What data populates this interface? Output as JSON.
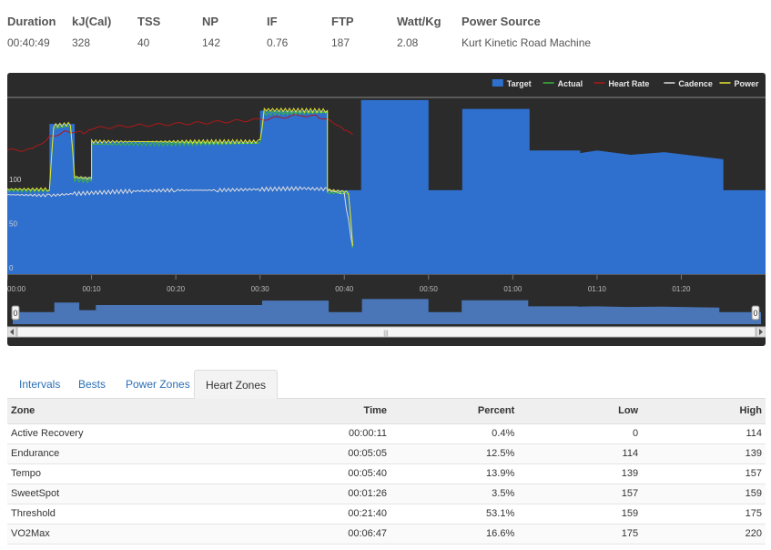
{
  "summary": [
    {
      "label": "Duration",
      "value": "00:40:49"
    },
    {
      "label": "kJ(Cal)",
      "value": "328"
    },
    {
      "label": "TSS",
      "value": "40"
    },
    {
      "label": "NP",
      "value": "142"
    },
    {
      "label": "IF",
      "value": "0.76"
    },
    {
      "label": "FTP",
      "value": "187"
    },
    {
      "label": "Watt/Kg",
      "value": "2.08"
    },
    {
      "label": "Power Source",
      "value": "Kurt Kinetic Road Machine"
    }
  ],
  "chart": {
    "legend": [
      {
        "name": "Target",
        "color": "#2f6fce",
        "kind": "box"
      },
      {
        "name": "Actual",
        "color": "#3cb43c",
        "kind": "line"
      },
      {
        "name": "Heart Rate",
        "color": "#b01818",
        "kind": "line"
      },
      {
        "name": "Cadence",
        "color": "#dddddd",
        "kind": "line"
      },
      {
        "name": "Power",
        "color": "#e6e632",
        "kind": "line"
      }
    ],
    "y_ticks": [
      "100",
      "50",
      "0"
    ],
    "x_ticks": [
      "00:00",
      "00:10",
      "00:20",
      "00:30",
      "00:40",
      "00:50",
      "01:00",
      "01:10",
      "01:20"
    ],
    "navigator_handle_left": "0",
    "navigator_handle_right": "0",
    "scroll_grip": "|||"
  },
  "chart_data": {
    "type": "area",
    "x_unit": "minutes",
    "xlim": [
      0,
      90
    ],
    "ylim": [
      0,
      200
    ],
    "series": [
      {
        "name": "Target",
        "points": [
          [
            0,
            95
          ],
          [
            5,
            95
          ],
          [
            5,
            170
          ],
          [
            8,
            170
          ],
          [
            8,
            110
          ],
          [
            10,
            110
          ],
          [
            10,
            150
          ],
          [
            30,
            150
          ],
          [
            30,
            185
          ],
          [
            38,
            185
          ],
          [
            38,
            95
          ],
          [
            42,
            95
          ],
          [
            42,
            197
          ],
          [
            50,
            197
          ],
          [
            50,
            95
          ],
          [
            54,
            95
          ],
          [
            54,
            187
          ],
          [
            62,
            187
          ],
          [
            62,
            140
          ],
          [
            68,
            140
          ],
          [
            68,
            137
          ],
          [
            70,
            140
          ],
          [
            74,
            135
          ],
          [
            78,
            138
          ],
          [
            85,
            130
          ],
          [
            85,
            95
          ],
          [
            90,
            95
          ]
        ]
      },
      {
        "name": "Actual",
        "points": [
          [
            0,
            95
          ],
          [
            5,
            95
          ],
          [
            5.5,
            165
          ],
          [
            7.5,
            168
          ],
          [
            8,
            107
          ],
          [
            10,
            105
          ],
          [
            10,
            147
          ],
          [
            30,
            148
          ],
          [
            30.5,
            182
          ],
          [
            38,
            183
          ],
          [
            38,
            92
          ],
          [
            40.5,
            92
          ],
          [
            41,
            30
          ]
        ]
      },
      {
        "name": "Heart Rate",
        "points": [
          [
            0,
            140
          ],
          [
            3,
            141
          ],
          [
            5,
            155
          ],
          [
            7,
            162
          ],
          [
            9,
            160
          ],
          [
            10,
            165
          ],
          [
            15,
            168
          ],
          [
            20,
            170
          ],
          [
            25,
            172
          ],
          [
            30,
            175
          ],
          [
            35,
            180
          ],
          [
            37,
            178
          ],
          [
            39,
            170
          ],
          [
            40,
            162
          ],
          [
            41,
            158
          ]
        ]
      },
      {
        "name": "Cadence",
        "points": [
          [
            0,
            90
          ],
          [
            5,
            89
          ],
          [
            8,
            91
          ],
          [
            10,
            92
          ],
          [
            15,
            94
          ],
          [
            20,
            95
          ],
          [
            25,
            95
          ],
          [
            30,
            96
          ],
          [
            35,
            97
          ],
          [
            38,
            96
          ],
          [
            40,
            90
          ],
          [
            41,
            30
          ]
        ]
      },
      {
        "name": "Power",
        "points": [
          [
            0,
            96
          ],
          [
            5,
            96
          ],
          [
            5.5,
            168
          ],
          [
            7.5,
            170
          ],
          [
            8,
            110
          ],
          [
            10,
            108
          ],
          [
            10,
            150
          ],
          [
            30,
            150
          ],
          [
            30.5,
            186
          ],
          [
            38,
            185
          ],
          [
            38,
            95
          ],
          [
            40.5,
            93
          ],
          [
            41,
            32
          ]
        ]
      }
    ]
  },
  "tabs": [
    {
      "label": "Intervals",
      "active": false
    },
    {
      "label": "Bests",
      "active": false
    },
    {
      "label": "Power Zones",
      "active": false
    },
    {
      "label": "Heart Zones",
      "active": true
    }
  ],
  "zones_table": {
    "headers": [
      "Zone",
      "Time",
      "Percent",
      "Low",
      "High"
    ],
    "rows": [
      [
        "Active Recovery",
        "00:00:11",
        "0.4%",
        "0",
        "114"
      ],
      [
        "Endurance",
        "00:05:05",
        "12.5%",
        "114",
        "139"
      ],
      [
        "Tempo",
        "00:05:40",
        "13.9%",
        "139",
        "157"
      ],
      [
        "SweetSpot",
        "00:01:26",
        "3.5%",
        "157",
        "159"
      ],
      [
        "Threshold",
        "00:21:40",
        "53.1%",
        "159",
        "175"
      ],
      [
        "VO2Max",
        "00:06:47",
        "16.6%",
        "175",
        "220"
      ]
    ]
  }
}
